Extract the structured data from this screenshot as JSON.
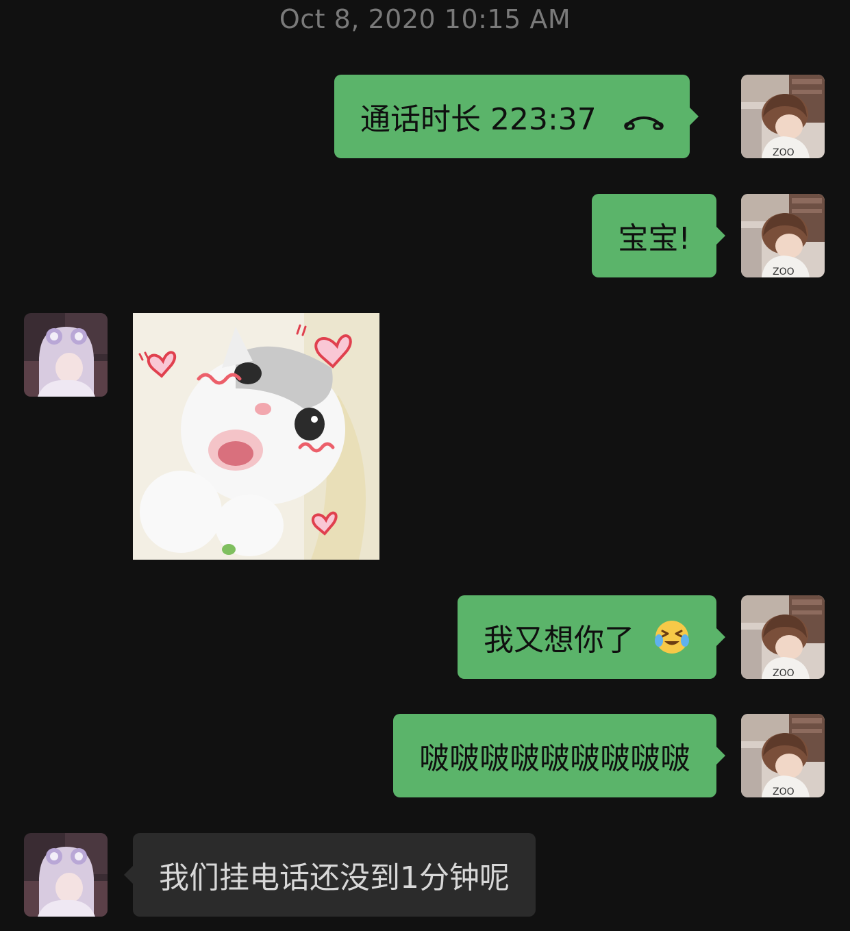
{
  "timestamp": "Oct 8, 2020 10:15 AM",
  "messages": [
    {
      "sender": "me",
      "type": "call",
      "text": "通话时长 223:37",
      "icon": "phone-hangup-icon"
    },
    {
      "sender": "me",
      "type": "text",
      "text": "宝宝!"
    },
    {
      "sender": "them",
      "type": "sticker",
      "icon": "cat-hearts-sticker"
    },
    {
      "sender": "me",
      "type": "text",
      "text": "我又想你了",
      "icon": "crying-laughing-emoji"
    },
    {
      "sender": "me",
      "type": "text",
      "text": "啵啵啵啵啵啵啵啵啵"
    },
    {
      "sender": "them",
      "type": "text",
      "text": "我们挂电话还没到1分钟呢"
    }
  ],
  "colors": {
    "background": "#111111",
    "my_bubble": "#5bb46a",
    "their_bubble": "#2b2b2b",
    "timestamp": "#7a7a7a"
  }
}
